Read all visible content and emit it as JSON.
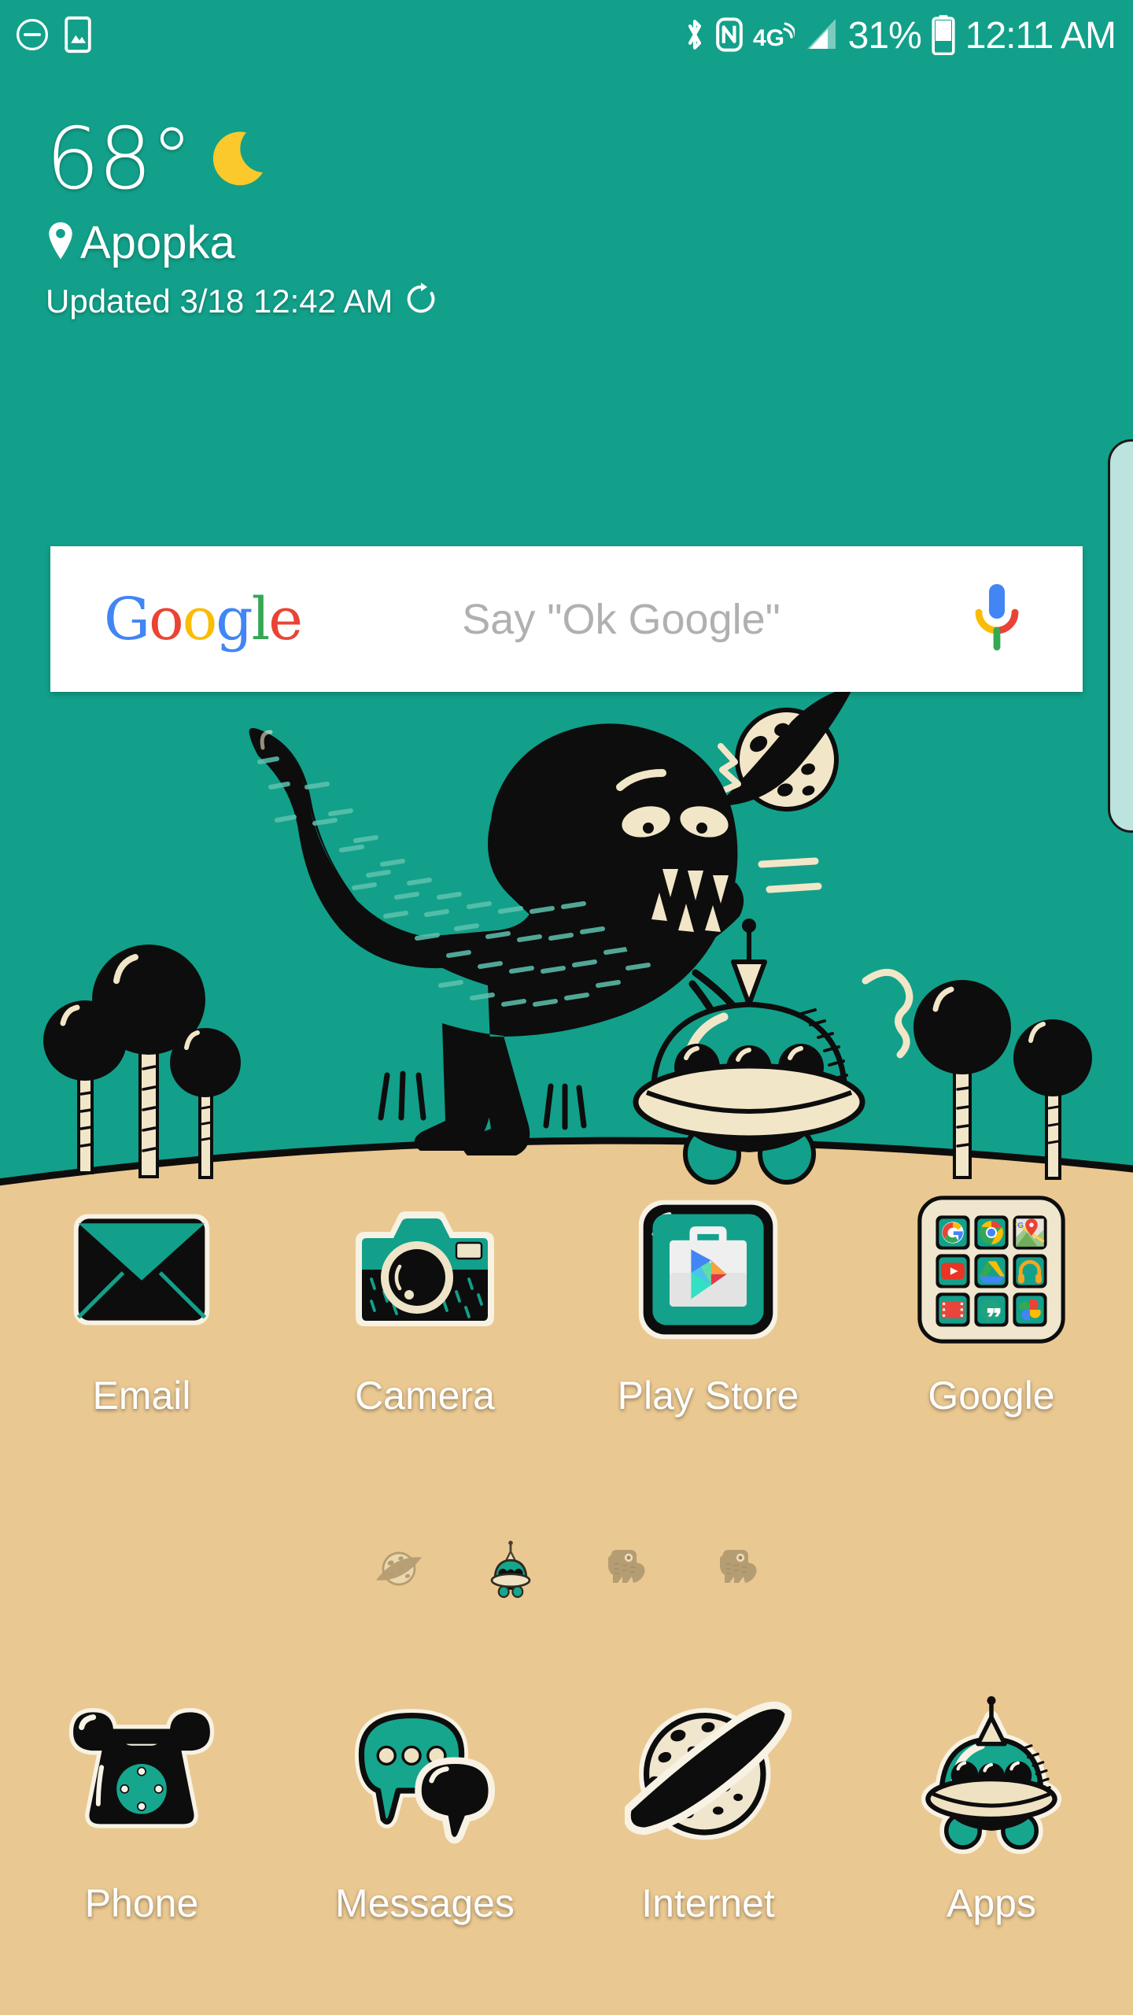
{
  "status_bar": {
    "left_icons": [
      {
        "name": "do-not-disturb-icon",
        "glyph": "minus-circle"
      },
      {
        "name": "screenshot-captured-icon",
        "glyph": "phone-image"
      }
    ],
    "right_icons": [
      {
        "name": "bluetooth-icon",
        "glyph": "bluetooth"
      },
      {
        "name": "nfc-icon",
        "glyph": "nfc"
      },
      {
        "name": "mobile-data-4g-icon",
        "glyph": "4G"
      },
      {
        "name": "signal-strength-icon",
        "glyph": "signal-bars"
      }
    ],
    "battery_percent": "31%",
    "clock": "12:11 AM"
  },
  "weather_widget": {
    "temperature": "68°",
    "condition_icon": "moon-icon",
    "city": "Apopka",
    "updated": "Updated 3/18 12:42 AM",
    "refresh_icon": "refresh-icon"
  },
  "search_bar": {
    "logo_letters": [
      {
        "char": "G",
        "color": "#4285F4"
      },
      {
        "char": "o",
        "color": "#EA4335"
      },
      {
        "char": "o",
        "color": "#FBBC05"
      },
      {
        "char": "g",
        "color": "#4285F4"
      },
      {
        "char": "l",
        "color": "#34A853"
      },
      {
        "char": "e",
        "color": "#EA4335"
      }
    ],
    "placeholder": "Say \"Ok Google\"",
    "mic_icon": "microphone-icon"
  },
  "app_row": [
    {
      "label": "Email",
      "icon": "email-icon"
    },
    {
      "label": "Camera",
      "icon": "camera-icon"
    },
    {
      "label": "Play Store",
      "icon": "play-store-icon"
    },
    {
      "label": "Google",
      "icon": "google-folder-icon",
      "folder_items": [
        "google-search-icon",
        "chrome-icon",
        "maps-icon",
        "youtube-icon",
        "drive-icon",
        "play-music-icon",
        "play-movies-icon",
        "hangouts-icon",
        "photos-icon"
      ]
    }
  ],
  "page_indicators": [
    {
      "name": "page-dot-planet",
      "icon": "planet-icon",
      "active": false
    },
    {
      "name": "page-dot-alien",
      "icon": "ufo-alien-icon",
      "active": true
    },
    {
      "name": "page-dot-dino-1",
      "icon": "dinosaur-icon",
      "active": false
    },
    {
      "name": "page-dot-dino-2",
      "icon": "dinosaur-icon",
      "active": false
    }
  ],
  "dock": [
    {
      "label": "Phone",
      "icon": "rotary-phone-icon"
    },
    {
      "label": "Messages",
      "icon": "speech-bubbles-icon"
    },
    {
      "label": "Internet",
      "icon": "ringed-planet-icon"
    },
    {
      "label": "Apps",
      "icon": "ufo-alien-icon"
    }
  ],
  "colors": {
    "sky": "#12A08A",
    "sand": "#EAC891",
    "ink": "#0D0D0D",
    "cream": "#F2E6C8",
    "teal_icon": "#12A08A",
    "edge_handle": "#BCE3DD"
  }
}
